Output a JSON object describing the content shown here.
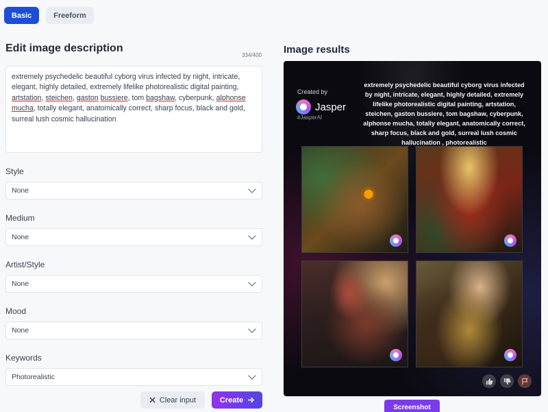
{
  "tabs": {
    "basic": "Basic",
    "freeform": "Freeform"
  },
  "edit": {
    "title": "Edit image description",
    "char_count": "334/400",
    "description_parts": [
      "extremely psychedelic beautiful cyborg virus infected by night, intricate, elegant, highly detailed, extremely lifelike photorealistic digital painting, ",
      "artstation",
      ", ",
      "steichen",
      ", ",
      "gaston",
      " ",
      "bussiere",
      ", tom ",
      "bagshaw",
      ", cyberpunk, ",
      "alphonse",
      " ",
      "mucha",
      ", totally elegant, anatomically correct, sharp focus, black and gold, surreal lush cosmic hallucination"
    ]
  },
  "fields": {
    "style": {
      "label": "Style",
      "value": "None"
    },
    "medium": {
      "label": "Medium",
      "value": "None"
    },
    "artist": {
      "label": "Artist/Style",
      "value": "None"
    },
    "mood": {
      "label": "Mood",
      "value": "None"
    },
    "keywords": {
      "label": "Keywords",
      "value": "Photorealistic"
    }
  },
  "actions": {
    "clear": "Clear input",
    "create": "Create"
  },
  "results": {
    "title": "Image results",
    "created_by": "Created by",
    "brand": "Jasper",
    "handle": "#JasperAI",
    "prompt": "extremely psychedelic beautiful cyborg virus infected by night, intricate, elegant, highly detailed, extremely lifelike photorealistic digital painting, artstation, steichen, gaston bussiere, tom bagshaw, cyberpunk, alphonse mucha, totally elegant, anatomically correct, sharp focus, black and gold, surreal lush cosmic hallucination , photorealistic"
  },
  "screenshot_label": "Screenshot",
  "colors": {
    "primary": "#1d4ed8",
    "create_gradient_start": "#9333ea",
    "create_gradient_end": "#4f46e5",
    "screenshot": "#7c3aed"
  }
}
